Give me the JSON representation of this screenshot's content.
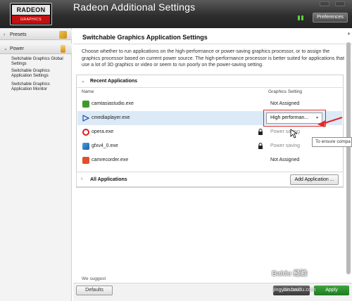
{
  "titlebar": {
    "logo_top": "RADEON",
    "logo_bottom": "GRAPHICS",
    "title": "Radeon Additional Settings",
    "preferences_label": "Preferences"
  },
  "sidebar": {
    "presets_label": "Presets",
    "power_label": "Power",
    "items": [
      {
        "label": "Switchable Graphics Global Settings"
      },
      {
        "label": "Switchable Graphics Application Settings"
      },
      {
        "label": "Switchable Graphics Application Monitor"
      }
    ]
  },
  "main": {
    "title": "Switchable Graphics Application Settings",
    "description": "Choose whether to run applications on the high-performance or power-saving graphics processor, or to assign the graphics processor based on current power source. The high-performance processor is better suited for applications that use a lot of 3D graphics or video or seem to run poorly on the power-saving setting.",
    "recent_label": "Recent Applications",
    "col_name": "Name",
    "col_setting": "Graphics Setting",
    "rows": [
      {
        "name": "camtasiastudio.exe",
        "setting": "Not Assigned",
        "icon": "camtasia-icon",
        "locked": false,
        "muted": false
      },
      {
        "name": "cmediaplayer.exe",
        "setting": "High performan...",
        "icon": "play-icon",
        "locked": false,
        "muted": false
      },
      {
        "name": "opera.exe",
        "setting": "Power saving",
        "icon": "opera-icon",
        "locked": true,
        "muted": true
      },
      {
        "name": "gfxv4_0.exe",
        "setting": "Power saving",
        "icon": "gfx-icon",
        "locked": true,
        "muted": true
      },
      {
        "name": "camrecorder.exe",
        "setting": "Not Assigned",
        "icon": "camrecorder-icon",
        "locked": false,
        "muted": false
      }
    ],
    "dropdown_value": "High performan...",
    "tooltip": "To ensure compa",
    "all_apps_label": "All Applications",
    "add_app_label": "Add Application ...",
    "suggest_text": "We suggest"
  },
  "footer": {
    "defaults_label": "Defaults",
    "discard_label": "Discard",
    "apply_label": "Apply",
    "watermark": "Baidu 经验",
    "watermark_sub": "jingyan.baidu.com"
  },
  "colors": {
    "accent_red": "#c31010",
    "highlight_red": "#e02a2a",
    "apply_green": "#2a8f2c",
    "selected_row": "#dceaf7"
  }
}
